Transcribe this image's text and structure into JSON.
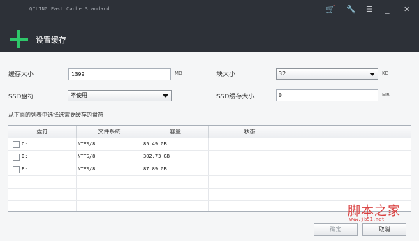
{
  "app": {
    "title": "QILING Fast Cache Standard",
    "page_title": "设置缓存"
  },
  "header_icons": [
    "cart-icon",
    "wrench-icon",
    "menu-icon",
    "minimize-icon",
    "close-icon"
  ],
  "header_glyphs": {
    "cart": "🛒",
    "wrench": "🔧",
    "menu": "☰",
    "minimize": "_",
    "close": "✕"
  },
  "form": {
    "cache_size_label": "缓存大小",
    "cache_size_value": "1399",
    "cache_size_unit": "MB",
    "block_size_label": "块大小",
    "block_size_value": "32",
    "block_size_unit": "KB",
    "ssd_label": "SSD盘符",
    "ssd_value": "不使用",
    "ssd_cache_label": "SSD缓存大小",
    "ssd_cache_value": "0",
    "ssd_cache_unit": "MB"
  },
  "list_hint": "从下面的列表中选择选需要缓存的盘符",
  "table": {
    "columns": [
      "盘符",
      "文件系统",
      "容量",
      "状态"
    ],
    "rows": [
      {
        "drive": "C:",
        "fs": "NTFS/8",
        "capacity": "85.49 GB",
        "status": ""
      },
      {
        "drive": "D:",
        "fs": "NTFS/8",
        "capacity": "302.73 GB",
        "status": ""
      },
      {
        "drive": "E:",
        "fs": "NTFS/8",
        "capacity": "87.89 GB",
        "status": ""
      }
    ]
  },
  "buttons": {
    "ok": "确定",
    "cancel": "取消"
  },
  "watermark": {
    "main": "脚本之家",
    "sub": "www.jb51.net"
  },
  "colors": {
    "header_bg": "#2d3138",
    "accent_green": "#2ec76a",
    "watermark": "#d94040"
  }
}
